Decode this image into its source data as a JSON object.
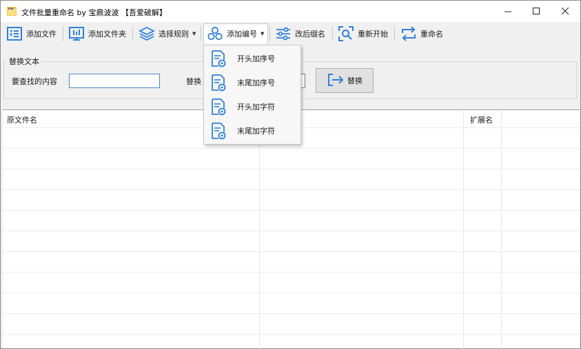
{
  "window": {
    "title": "文件批量重命名 by 宝鼎波波 【吾爱破解】",
    "controls": {
      "minimize": "–",
      "maximize": "☐",
      "close": "✕"
    }
  },
  "toolbar": {
    "items": [
      {
        "label": "添加文件",
        "icon": "add-file-icon"
      },
      {
        "label": "添加文件夹",
        "icon": "add-folder-icon"
      },
      {
        "label": "选择规则",
        "icon": "layers-icon",
        "has_dropdown": true
      },
      {
        "label": "添加编号",
        "icon": "numbering-icon",
        "has_dropdown": true,
        "active": true
      },
      {
        "label": "改后缀名",
        "icon": "sliders-icon"
      },
      {
        "label": "重新开始",
        "icon": "restart-search-icon"
      },
      {
        "label": "重命名",
        "icon": "rename-arrows-icon"
      }
    ]
  },
  "replace_group": {
    "title": "替换文本",
    "find_label": "要查找的内容",
    "find_value": "",
    "replace_label": "替换",
    "replace_value": "",
    "replace_button": "替换"
  },
  "grid": {
    "columns": [
      "原文件名",
      "",
      "扩展名"
    ],
    "rows": []
  },
  "dropdown_menu": {
    "items": [
      "开头加序号",
      "末尾加序号",
      "开头加字符",
      "末尾加字符"
    ]
  },
  "colors": {
    "icon_blue": "#2f7fd6",
    "window_bg": "#f0f0f0",
    "grid_bg": "#ffffff"
  }
}
